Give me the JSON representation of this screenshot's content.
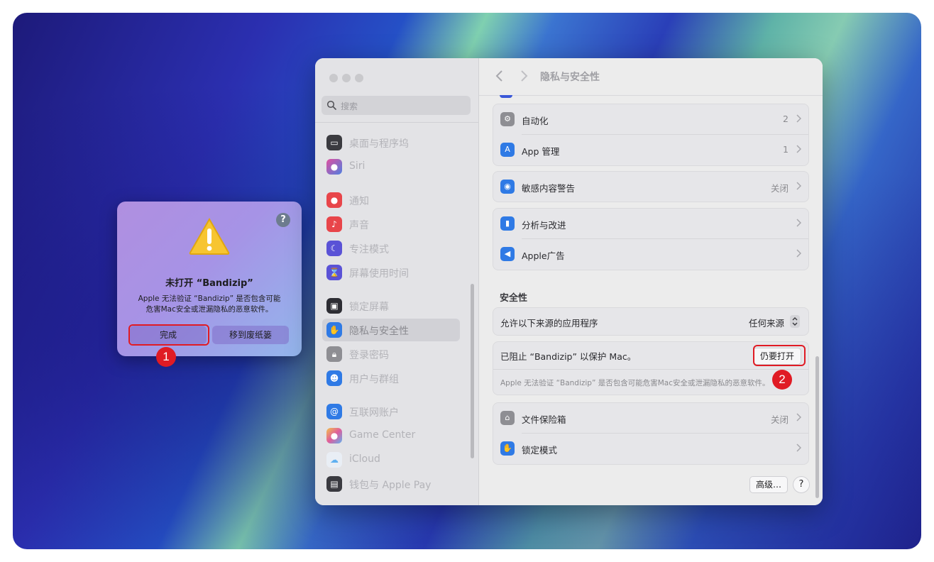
{
  "alert": {
    "title": "未打开 “Bandizip”",
    "message_line1": "Apple 无法验证 “Bandizip” 是否包含可能",
    "message_line2": "危害Mac安全或泄漏隐私的恶意软件。",
    "done_label": "完成",
    "trash_label": "移到废纸篓",
    "help_label": "?"
  },
  "badges": {
    "one": "1",
    "two": "2"
  },
  "sidebar": {
    "search_placeholder": "搜索",
    "items": [
      {
        "label": "桌面与程序坞",
        "icon": "dock-icon",
        "color": "#3b3b40"
      },
      {
        "label": "Siri",
        "icon": "siri-icon",
        "color": "#7a4fd0"
      },
      {
        "label": "通知",
        "icon": "bell-icon",
        "color": "#e8454a"
      },
      {
        "label": "声音",
        "icon": "speaker-icon",
        "color": "#e8454a"
      },
      {
        "label": "专注模式",
        "icon": "moon-icon",
        "color": "#5a52d6"
      },
      {
        "label": "屏幕使用时间",
        "icon": "hourglass-icon",
        "color": "#5a52d6"
      },
      {
        "label": "锁定屏幕",
        "icon": "lock-icon",
        "color": "#2d2d33"
      },
      {
        "label": "隐私与安全性",
        "icon": "hand-icon",
        "color": "#2f7ae5"
      },
      {
        "label": "登录密码",
        "icon": "padlock-icon",
        "color": "#8e8e93"
      },
      {
        "label": "用户与群组",
        "icon": "users-icon",
        "color": "#2f7ae5"
      },
      {
        "label": "互联网账户",
        "icon": "at-icon",
        "color": "#2f7ae5"
      },
      {
        "label": "Game Center",
        "icon": "gamecenter-icon",
        "color": "#e05d9c"
      },
      {
        "label": "iCloud",
        "icon": "cloud-icon",
        "color": "#5fb0f0"
      },
      {
        "label": "钱包与 Apple Pay",
        "icon": "wallet-icon",
        "color": "#3a3a40"
      }
    ]
  },
  "header": {
    "title": "隐私与安全性"
  },
  "groups": {
    "automation": {
      "label": "自动化",
      "value": "2",
      "color": "#8e8e93"
    },
    "app_management": {
      "label": "App 管理",
      "value": "1",
      "color": "#2f7ae5"
    },
    "sensitive": {
      "label": "敏感内容警告",
      "value": "关闭",
      "color": "#2f7ae5"
    },
    "analytics": {
      "label": "分析与改进",
      "value": "",
      "color": "#2f7ae5"
    },
    "apple_ads": {
      "label": "Apple广告",
      "value": "",
      "color": "#2f7ae5"
    }
  },
  "security": {
    "section_title": "安全性",
    "allow_label": "允许以下来源的应用程序",
    "allow_value": "任何来源",
    "blocked_label": "已阻止 “Bandizip” 以保护 Mac。",
    "open_anyway_label": "仍要打开",
    "blocked_desc": "Apple 无法验证 “Bandizip” 是否包含可能危害Mac安全或泄漏隐私的恶意软件。",
    "filevault": {
      "label": "文件保险箱",
      "value": "关闭",
      "color": "#8e8e93"
    },
    "lockdown": {
      "label": "锁定模式",
      "value": "",
      "color": "#2f7ae5"
    }
  },
  "footer": {
    "advanced_label": "高级…",
    "help_label": "?"
  }
}
